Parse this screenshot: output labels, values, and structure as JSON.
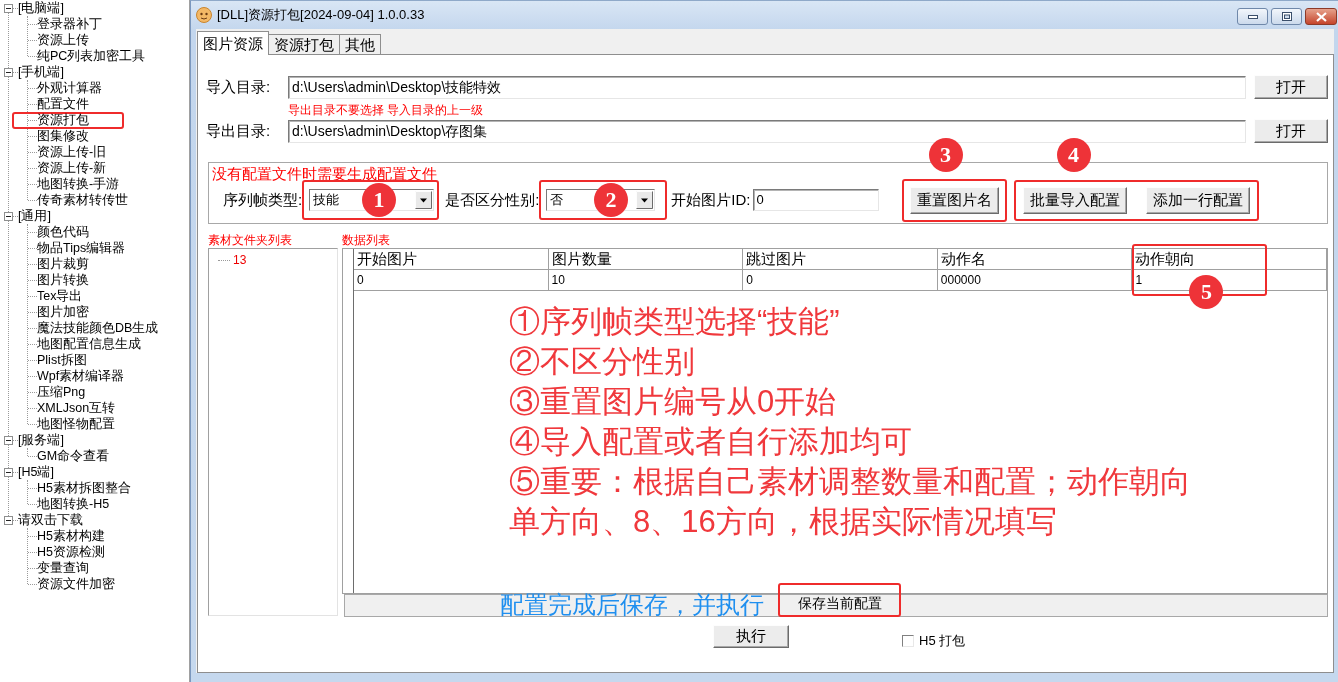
{
  "sidebar": {
    "tree": [
      {
        "label": "[电脑端]",
        "expanded": true,
        "children": [
          {
            "label": "登录器补丁",
            "highlighted": false
          },
          {
            "label": "资源上传",
            "highlighted": false
          },
          {
            "label": "纯PC列表加密工具",
            "highlighted": false
          }
        ]
      },
      {
        "label": "[手机端]",
        "expanded": true,
        "children": [
          {
            "label": "外观计算器",
            "highlighted": false
          },
          {
            "label": "配置文件",
            "highlighted": false
          },
          {
            "label": "资源打包",
            "highlighted": true
          },
          {
            "label": "图集修改",
            "highlighted": false
          },
          {
            "label": "资源上传-旧",
            "highlighted": false
          },
          {
            "label": "资源上传-新",
            "highlighted": false
          },
          {
            "label": "地图转换-手游",
            "highlighted": false
          },
          {
            "label": "传奇素材转传世",
            "highlighted": false
          }
        ]
      },
      {
        "label": "[通用]",
        "expanded": true,
        "children": [
          {
            "label": "颜色代码",
            "highlighted": false
          },
          {
            "label": "物品Tips编辑器",
            "highlighted": false
          },
          {
            "label": "图片裁剪",
            "highlighted": false
          },
          {
            "label": "图片转换",
            "highlighted": false
          },
          {
            "label": "Tex导出",
            "highlighted": false
          },
          {
            "label": "图片加密",
            "highlighted": false
          },
          {
            "label": "魔法技能颜色DB生成",
            "highlighted": false
          },
          {
            "label": "地图配置信息生成",
            "highlighted": false
          },
          {
            "label": "Plist拆图",
            "highlighted": false
          },
          {
            "label": "Wpf素材编译器",
            "highlighted": false
          },
          {
            "label": "压缩Png",
            "highlighted": false
          },
          {
            "label": "XMLJson互转",
            "highlighted": false
          },
          {
            "label": "地图怪物配置",
            "highlighted": false
          }
        ]
      },
      {
        "label": "[服务端]",
        "expanded": true,
        "children": [
          {
            "label": "GM命令查看",
            "highlighted": false
          }
        ]
      },
      {
        "label": "[H5端]",
        "expanded": true,
        "children": [
          {
            "label": "H5素材拆图整合",
            "highlighted": false
          },
          {
            "label": "地图转换-H5",
            "highlighted": false
          }
        ]
      },
      {
        "label": "请双击下载",
        "expanded": true,
        "children": [
          {
            "label": "H5素材构建",
            "highlighted": false
          },
          {
            "label": "H5资源检测",
            "highlighted": false
          },
          {
            "label": "变量查询",
            "highlighted": false
          },
          {
            "label": "资源文件加密",
            "highlighted": false
          }
        ]
      }
    ]
  },
  "window": {
    "title": "[DLL]资源打包[2024-09-04] 1.0.0.33"
  },
  "tabs": [
    {
      "label": "图片资源",
      "selected": true
    },
    {
      "label": "资源打包",
      "selected": false
    },
    {
      "label": "其他",
      "selected": false
    }
  ],
  "directories": [
    {
      "label": "导入目录:",
      "value": "d:\\Users\\admin\\Desktop\\技能特效",
      "button": "打开",
      "note": "导出目录不要选择 导入目录的上一级"
    },
    {
      "label": "导出目录:",
      "value": "d:\\Users\\admin\\Desktop\\存图集",
      "button": "打开"
    }
  ],
  "config_group": {
    "title": "没有配置文件时需要生成配置文件",
    "fields": [
      {
        "kind": "dropdown",
        "label": "序列帧类型:",
        "value": "技能",
        "badge": "1"
      },
      {
        "kind": "dropdown",
        "label": "是否区分性别:",
        "value": "否",
        "badge": "2"
      },
      {
        "kind": "text",
        "label": "开始图片ID:",
        "value": "0"
      }
    ],
    "button_groups": [
      {
        "badge": "3",
        "buttons": [
          "重置图片名"
        ]
      },
      {
        "badge": "4",
        "buttons": [
          "批量导入配置",
          "添加一行配置"
        ]
      }
    ]
  },
  "folder_list": {
    "title": "素材文件夹列表",
    "items": [
      "13"
    ]
  },
  "data_list": {
    "title": "数据列表",
    "columns": [
      {
        "label": "开始图片"
      },
      {
        "label": "图片数量"
      },
      {
        "label": "跳过图片"
      },
      {
        "label": "动作名"
      },
      {
        "label": "动作朝向",
        "badge": "5"
      }
    ],
    "rows": [
      [
        "0",
        "10",
        "0",
        "000000",
        "1"
      ]
    ]
  },
  "notes": [
    "①序列帧类型选择“技能”",
    "②不区分性别",
    "③重置图片编号从0开始",
    "④导入配置或者自行添加均可",
    "⑤重要：根据自己素材调整数量和配置；动作朝向",
    "单方向、8、16方向，根据实际情况填写"
  ],
  "save_bar": {
    "note": "配置完成后保存，并执行",
    "button": "保存当前配置",
    "highlighted": true
  },
  "footer": {
    "execute_button": "执行",
    "checkbox": {
      "label": "H5 打包",
      "checked": false
    }
  }
}
